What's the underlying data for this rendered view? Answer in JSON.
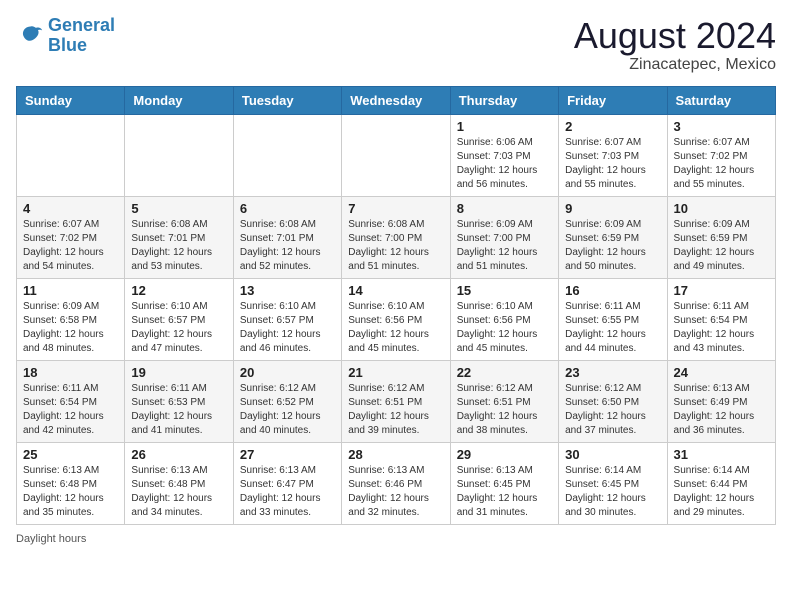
{
  "header": {
    "logo_line1": "General",
    "logo_line2": "Blue",
    "month_title": "August 2024",
    "location": "Zinacatepec, Mexico"
  },
  "days_of_week": [
    "Sunday",
    "Monday",
    "Tuesday",
    "Wednesday",
    "Thursday",
    "Friday",
    "Saturday"
  ],
  "weeks": [
    [
      {
        "day": "",
        "info": ""
      },
      {
        "day": "",
        "info": ""
      },
      {
        "day": "",
        "info": ""
      },
      {
        "day": "",
        "info": ""
      },
      {
        "day": "1",
        "info": "Sunrise: 6:06 AM\nSunset: 7:03 PM\nDaylight: 12 hours\nand 56 minutes."
      },
      {
        "day": "2",
        "info": "Sunrise: 6:07 AM\nSunset: 7:03 PM\nDaylight: 12 hours\nand 55 minutes."
      },
      {
        "day": "3",
        "info": "Sunrise: 6:07 AM\nSunset: 7:02 PM\nDaylight: 12 hours\nand 55 minutes."
      }
    ],
    [
      {
        "day": "4",
        "info": "Sunrise: 6:07 AM\nSunset: 7:02 PM\nDaylight: 12 hours\nand 54 minutes."
      },
      {
        "day": "5",
        "info": "Sunrise: 6:08 AM\nSunset: 7:01 PM\nDaylight: 12 hours\nand 53 minutes."
      },
      {
        "day": "6",
        "info": "Sunrise: 6:08 AM\nSunset: 7:01 PM\nDaylight: 12 hours\nand 52 minutes."
      },
      {
        "day": "7",
        "info": "Sunrise: 6:08 AM\nSunset: 7:00 PM\nDaylight: 12 hours\nand 51 minutes."
      },
      {
        "day": "8",
        "info": "Sunrise: 6:09 AM\nSunset: 7:00 PM\nDaylight: 12 hours\nand 51 minutes."
      },
      {
        "day": "9",
        "info": "Sunrise: 6:09 AM\nSunset: 6:59 PM\nDaylight: 12 hours\nand 50 minutes."
      },
      {
        "day": "10",
        "info": "Sunrise: 6:09 AM\nSunset: 6:59 PM\nDaylight: 12 hours\nand 49 minutes."
      }
    ],
    [
      {
        "day": "11",
        "info": "Sunrise: 6:09 AM\nSunset: 6:58 PM\nDaylight: 12 hours\nand 48 minutes."
      },
      {
        "day": "12",
        "info": "Sunrise: 6:10 AM\nSunset: 6:57 PM\nDaylight: 12 hours\nand 47 minutes."
      },
      {
        "day": "13",
        "info": "Sunrise: 6:10 AM\nSunset: 6:57 PM\nDaylight: 12 hours\nand 46 minutes."
      },
      {
        "day": "14",
        "info": "Sunrise: 6:10 AM\nSunset: 6:56 PM\nDaylight: 12 hours\nand 45 minutes."
      },
      {
        "day": "15",
        "info": "Sunrise: 6:10 AM\nSunset: 6:56 PM\nDaylight: 12 hours\nand 45 minutes."
      },
      {
        "day": "16",
        "info": "Sunrise: 6:11 AM\nSunset: 6:55 PM\nDaylight: 12 hours\nand 44 minutes."
      },
      {
        "day": "17",
        "info": "Sunrise: 6:11 AM\nSunset: 6:54 PM\nDaylight: 12 hours\nand 43 minutes."
      }
    ],
    [
      {
        "day": "18",
        "info": "Sunrise: 6:11 AM\nSunset: 6:54 PM\nDaylight: 12 hours\nand 42 minutes."
      },
      {
        "day": "19",
        "info": "Sunrise: 6:11 AM\nSunset: 6:53 PM\nDaylight: 12 hours\nand 41 minutes."
      },
      {
        "day": "20",
        "info": "Sunrise: 6:12 AM\nSunset: 6:52 PM\nDaylight: 12 hours\nand 40 minutes."
      },
      {
        "day": "21",
        "info": "Sunrise: 6:12 AM\nSunset: 6:51 PM\nDaylight: 12 hours\nand 39 minutes."
      },
      {
        "day": "22",
        "info": "Sunrise: 6:12 AM\nSunset: 6:51 PM\nDaylight: 12 hours\nand 38 minutes."
      },
      {
        "day": "23",
        "info": "Sunrise: 6:12 AM\nSunset: 6:50 PM\nDaylight: 12 hours\nand 37 minutes."
      },
      {
        "day": "24",
        "info": "Sunrise: 6:13 AM\nSunset: 6:49 PM\nDaylight: 12 hours\nand 36 minutes."
      }
    ],
    [
      {
        "day": "25",
        "info": "Sunrise: 6:13 AM\nSunset: 6:48 PM\nDaylight: 12 hours\nand 35 minutes."
      },
      {
        "day": "26",
        "info": "Sunrise: 6:13 AM\nSunset: 6:48 PM\nDaylight: 12 hours\nand 34 minutes."
      },
      {
        "day": "27",
        "info": "Sunrise: 6:13 AM\nSunset: 6:47 PM\nDaylight: 12 hours\nand 33 minutes."
      },
      {
        "day": "28",
        "info": "Sunrise: 6:13 AM\nSunset: 6:46 PM\nDaylight: 12 hours\nand 32 minutes."
      },
      {
        "day": "29",
        "info": "Sunrise: 6:13 AM\nSunset: 6:45 PM\nDaylight: 12 hours\nand 31 minutes."
      },
      {
        "day": "30",
        "info": "Sunrise: 6:14 AM\nSunset: 6:45 PM\nDaylight: 12 hours\nand 30 minutes."
      },
      {
        "day": "31",
        "info": "Sunrise: 6:14 AM\nSunset: 6:44 PM\nDaylight: 12 hours\nand 29 minutes."
      }
    ]
  ],
  "footer": {
    "note": "Daylight hours"
  }
}
